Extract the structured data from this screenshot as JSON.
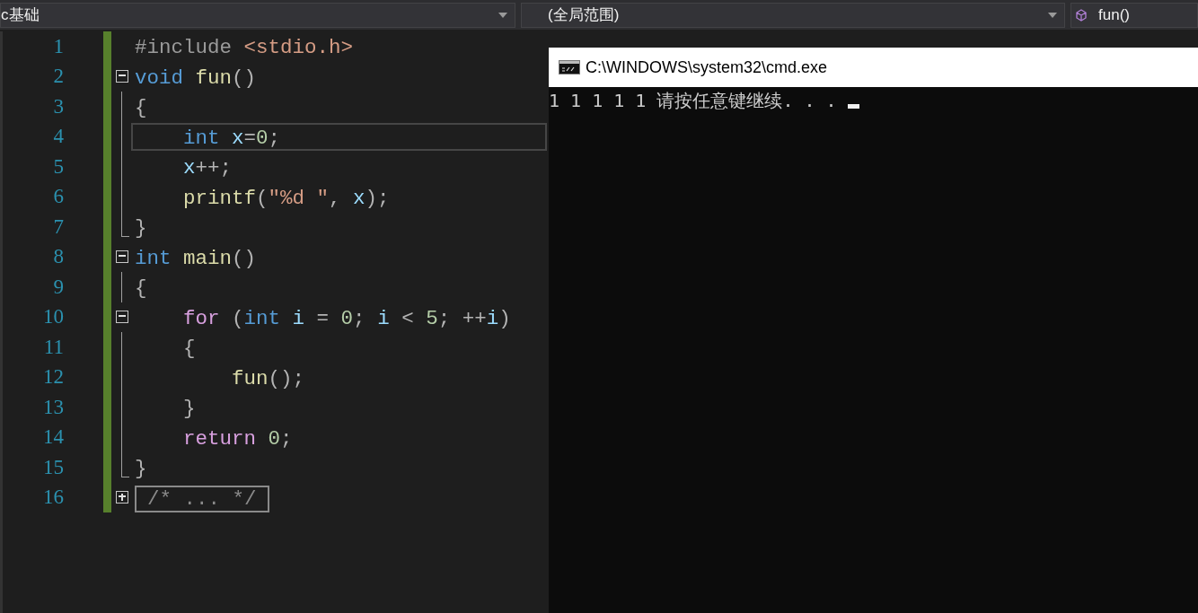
{
  "toolbar": {
    "project": "c基础",
    "scope": "(全局范围)",
    "member": "fun()"
  },
  "editor": {
    "lines": [
      {
        "number": "1",
        "kind": "none",
        "current": false,
        "tokens": [
          {
            "text": "#include ",
            "kind": "preproc"
          },
          {
            "text": "<stdio.h>",
            "kind": "string"
          }
        ]
      },
      {
        "number": "2",
        "kind": "collapse",
        "current": false,
        "tokens": [
          {
            "text": "void ",
            "kind": "keyword"
          },
          {
            "text": "fun",
            "kind": "function"
          },
          {
            "text": "()",
            "kind": "punct"
          }
        ]
      },
      {
        "number": "3",
        "kind": "guide",
        "current": false,
        "tokens": [
          {
            "text": "{",
            "kind": "punct"
          }
        ]
      },
      {
        "number": "4",
        "kind": "guide",
        "current": true,
        "tokens": [
          {
            "text": "    int ",
            "kind": "keyword"
          },
          {
            "text": "x",
            "kind": "variable"
          },
          {
            "text": "=",
            "kind": "punct"
          },
          {
            "text": "0",
            "kind": "number"
          },
          {
            "text": ";",
            "kind": "punct"
          }
        ]
      },
      {
        "number": "5",
        "kind": "guide",
        "current": false,
        "tokens": [
          {
            "text": "    x",
            "kind": "variable"
          },
          {
            "text": "++;",
            "kind": "punct"
          }
        ]
      },
      {
        "number": "6",
        "kind": "guide",
        "current": false,
        "tokens": [
          {
            "text": "    printf",
            "kind": "function"
          },
          {
            "text": "(",
            "kind": "punct"
          },
          {
            "text": "\"%d \"",
            "kind": "string"
          },
          {
            "text": ", ",
            "kind": "punct"
          },
          {
            "text": "x",
            "kind": "variable"
          },
          {
            "text": ");",
            "kind": "punct"
          }
        ]
      },
      {
        "number": "7",
        "kind": "end",
        "current": false,
        "tokens": [
          {
            "text": "}",
            "kind": "punct"
          }
        ]
      },
      {
        "number": "8",
        "kind": "collapse",
        "current": false,
        "tokens": [
          {
            "text": "int ",
            "kind": "keyword"
          },
          {
            "text": "main",
            "kind": "function"
          },
          {
            "text": "()",
            "kind": "punct"
          }
        ]
      },
      {
        "number": "9",
        "kind": "guide",
        "current": false,
        "tokens": [
          {
            "text": "{",
            "kind": "punct"
          }
        ]
      },
      {
        "number": "10",
        "kind": "collapse",
        "current": false,
        "tokens": [
          {
            "text": "    for ",
            "kind": "control"
          },
          {
            "text": "(",
            "kind": "punct"
          },
          {
            "text": "int ",
            "kind": "keyword"
          },
          {
            "text": "i",
            "kind": "variable"
          },
          {
            "text": " = ",
            "kind": "punct"
          },
          {
            "text": "0",
            "kind": "number"
          },
          {
            "text": "; ",
            "kind": "punct"
          },
          {
            "text": "i",
            "kind": "variable"
          },
          {
            "text": " < ",
            "kind": "punct"
          },
          {
            "text": "5",
            "kind": "number"
          },
          {
            "text": "; ++",
            "kind": "punct"
          },
          {
            "text": "i",
            "kind": "variable"
          },
          {
            "text": ")",
            "kind": "punct"
          }
        ]
      },
      {
        "number": "11",
        "kind": "guide",
        "current": false,
        "tokens": [
          {
            "text": "    {",
            "kind": "punct"
          }
        ]
      },
      {
        "number": "12",
        "kind": "guide",
        "current": false,
        "tokens": [
          {
            "text": "        fun",
            "kind": "function"
          },
          {
            "text": "();",
            "kind": "punct"
          }
        ]
      },
      {
        "number": "13",
        "kind": "guide",
        "current": false,
        "tokens": [
          {
            "text": "    }",
            "kind": "punct"
          }
        ]
      },
      {
        "number": "14",
        "kind": "guide",
        "current": false,
        "tokens": [
          {
            "text": "    return ",
            "kind": "control"
          },
          {
            "text": "0",
            "kind": "number"
          },
          {
            "text": ";",
            "kind": "punct"
          }
        ]
      },
      {
        "number": "15",
        "kind": "end",
        "current": false,
        "tokens": [
          {
            "text": "}",
            "kind": "punct"
          }
        ]
      },
      {
        "number": "16",
        "kind": "expand",
        "current": false,
        "tokens": [
          {
            "text": "/* ... */",
            "kind": "collapsed"
          }
        ]
      }
    ]
  },
  "console": {
    "title": "C:\\WINDOWS\\system32\\cmd.exe",
    "output": "1 1 1 1 1 请按任意键继续. . . "
  }
}
